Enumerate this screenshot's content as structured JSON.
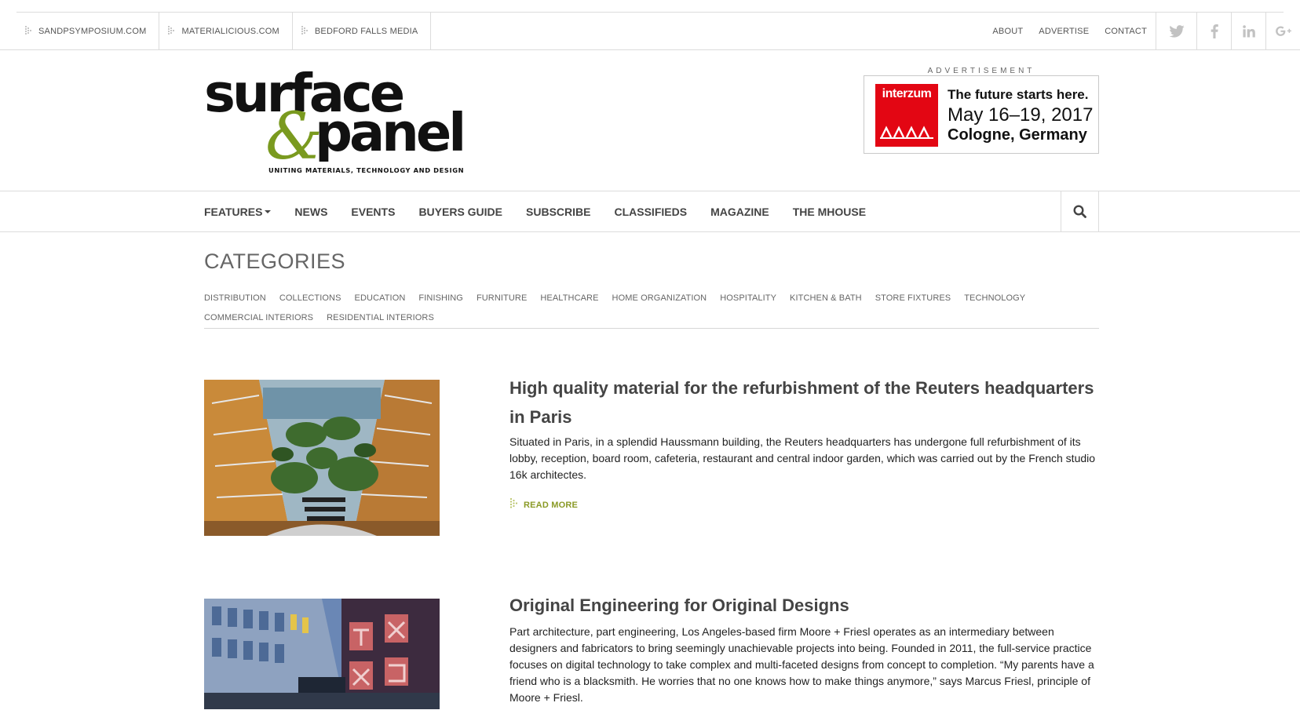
{
  "top_bar": {
    "sites": [
      "SANDPSYMPOSIUM.COM",
      "MATERIALICIOUS.COM",
      "BEDFORD FALLS MEDIA"
    ],
    "links": [
      "ABOUT",
      "ADVERTISE",
      "CONTACT"
    ],
    "social_icons": [
      "twitter-icon",
      "facebook-icon",
      "linkedin-icon",
      "google-plus-icon"
    ]
  },
  "logo": {
    "word1": "surface",
    "amp": "&",
    "word2": "panel",
    "tagline": "UNITING MATERIALS, TECHNOLOGY AND DESIGN",
    "accent_color": "#7a9a1f"
  },
  "advertisement": {
    "label": "ADVERTISEMENT",
    "brand": "interzum",
    "line1": "The future starts here.",
    "line2": "May 16–19, 2017",
    "line3": "Cologne, Germany",
    "brand_color": "#e30613"
  },
  "nav": {
    "items": [
      "FEATURES",
      "NEWS",
      "EVENTS",
      "BUYERS GUIDE",
      "SUBSCRIBE",
      "CLASSIFIEDS",
      "MAGAZINE",
      "THE MHOUSE"
    ],
    "search_icon": "search-icon"
  },
  "categories": {
    "title": "CATEGORIES",
    "items": [
      "DISTRIBUTION",
      "COLLECTIONS",
      "EDUCATION",
      "FINISHING",
      "FURNITURE",
      "HEALTHCARE",
      "HOME ORGANIZATION",
      "HOSPITALITY",
      "KITCHEN & BATH",
      "STORE FIXTURES",
      "TECHNOLOGY",
      "COMMERCIAL INTERIORS",
      "RESIDENTIAL INTERIORS"
    ]
  },
  "articles": [
    {
      "title": "High quality material for the refurbishment of the Reuters headquarters in Paris",
      "excerpt": "Situated in Paris, in a splendid Haussmann building, the Reuters headquarters has undergone full refurbishment of its lobby, reception, board room, cafeteria, restaurant and central indoor garden, which was carried out by the French studio 16k architectes.",
      "read_more": "READ MORE"
    },
    {
      "title": "Original Engineering for Original Designs",
      "excerpt": "Part architecture, part engineering, Los Angeles-based firm Moore + Friesl operates as an intermediary between designers and fabricators to bring seemingly unachievable projects into being. Founded in 2011, the full-service practice focuses on digital technology to take complex and multi-faceted designs from concept to completion. “My parents have a friend who is a blacksmith. He worries that no one knows how to make things anymore,” says Marcus Friesl, principle of Moore + Friesl."
    }
  ]
}
